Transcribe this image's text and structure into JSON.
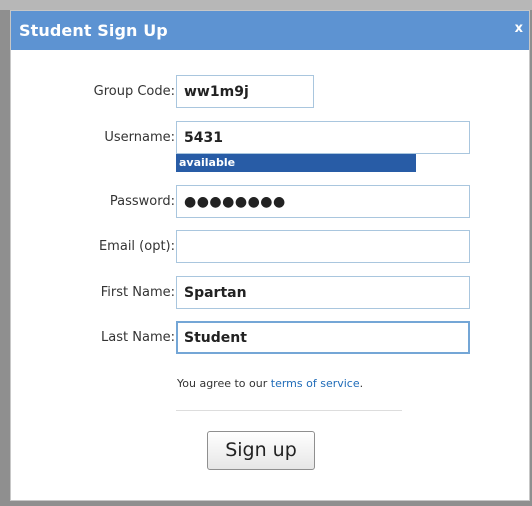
{
  "dialog": {
    "title": "Student Sign Up",
    "close_label": "x"
  },
  "form": {
    "group_code": {
      "label": "Group Code:",
      "value": "ww1m9j"
    },
    "username": {
      "label": "Username:",
      "value": "5431",
      "status": "available"
    },
    "password": {
      "label": "Password:",
      "value": "●●●●●●●●"
    },
    "email": {
      "label": "Email (opt):",
      "value": ""
    },
    "first_name": {
      "label": "First Name:",
      "value": "Spartan"
    },
    "last_name": {
      "label": "Last Name:",
      "value": "Student"
    }
  },
  "agreement": {
    "prefix": "You agree to our ",
    "link": "terms of service",
    "suffix": "."
  },
  "submit": {
    "label": "Sign up"
  },
  "colors": {
    "titlebar": "#5d93d2",
    "available_badge": "#285ca6",
    "link": "#1e6bb8",
    "input_border": "#a9c6de",
    "focus_border": "#74a6d6"
  }
}
